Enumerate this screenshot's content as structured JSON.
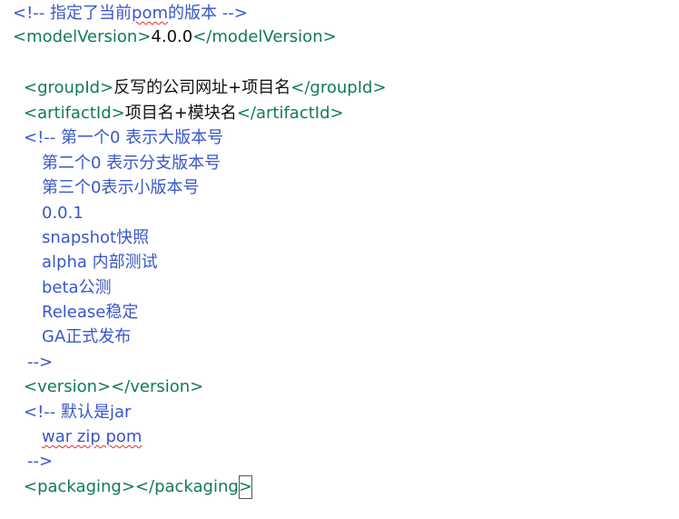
{
  "lines": {
    "l1_comment_pre": "<!-- 指定了当前",
    "l1_comment_pom": "pom",
    "l1_comment_post": "的版本 -->",
    "l2_open_tag": "<modelVersion>",
    "l2_value": "4.0.0",
    "l2_close_tag": "</modelVersion>",
    "l3_open_tag": "<groupId>",
    "l3_value": "反写的公司网址+项目名",
    "l3_close_tag": "</groupId>",
    "l4_open_tag": "<artifactId>",
    "l4_value": "项目名+模块名",
    "l4_close_tag": "</artifactId>",
    "l5_comment": "<!-- 第一个0 表示大版本号",
    "l6_comment": "第二个0 表示分支版本号",
    "l7_comment": "第三个0表示小版本号",
    "l8_comment": "0.0.1",
    "l9_comment": "snapshot快照",
    "l10_comment": "alpha 内部测试",
    "l11_comment": "beta公测",
    "l12_comment": "Release稳定",
    "l13_comment": "GA正式发布",
    "l14_comment": "-->",
    "l15_open_tag": "<version>",
    "l15_close_tag": "</version>",
    "l16_comment": "<!-- 默认是jar",
    "l17_comment": "war zip pom",
    "l18_comment": "-->",
    "l19_open_tag": "<packaging>",
    "l19_close_tag": "</packaging",
    "l19_last_char": ">"
  },
  "colors": {
    "comment": "#3a56c9",
    "tag": "#117a5b",
    "text": "#111111",
    "spellcheck": "#e03030"
  }
}
